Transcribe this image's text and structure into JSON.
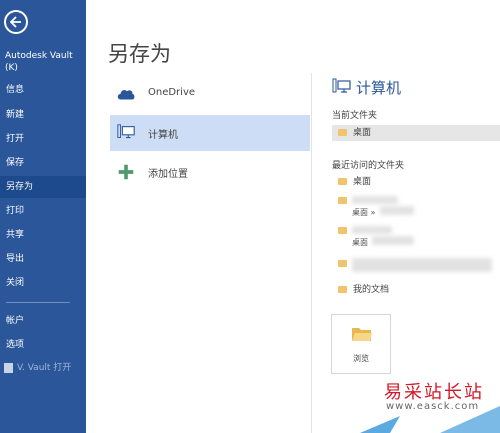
{
  "nav": {
    "app_name": "Autodesk Vault\n(K)",
    "items": [
      {
        "label": "信息"
      },
      {
        "label": "新建"
      },
      {
        "label": "打开"
      },
      {
        "label": "保存"
      },
      {
        "label": "另存为"
      },
      {
        "label": "打印"
      },
      {
        "label": "共享"
      },
      {
        "label": "导出"
      },
      {
        "label": "关闭"
      },
      {
        "label": "帐户"
      },
      {
        "label": "选项"
      }
    ],
    "vault_open": "V. Vault 打开",
    "active_index": 4
  },
  "main": {
    "title": "另存为",
    "places": [
      {
        "label": "OneDrive",
        "icon": "cloud-icon"
      },
      {
        "label": "计算机",
        "icon": "computer-icon"
      },
      {
        "label": "添加位置",
        "icon": "plus-icon"
      }
    ]
  },
  "panel": {
    "title": "计算机",
    "current_folder_label": "当前文件夹",
    "current_folder": "桌面",
    "recent_label": "最近访问的文件夹",
    "recent": [
      {
        "label": "桌面"
      },
      {
        "label": "桌面 »"
      },
      {
        "label": "桌面"
      },
      {
        "label": "我的文档"
      }
    ],
    "browse_label": "浏览"
  },
  "watermark": {
    "title": "易采站长站",
    "url": "www.easck.com"
  },
  "colors": {
    "nav_bg": "#2b579a",
    "accent": "#2b579a",
    "selected_bg": "#cdddf5",
    "watermark": "#d01a2a"
  }
}
